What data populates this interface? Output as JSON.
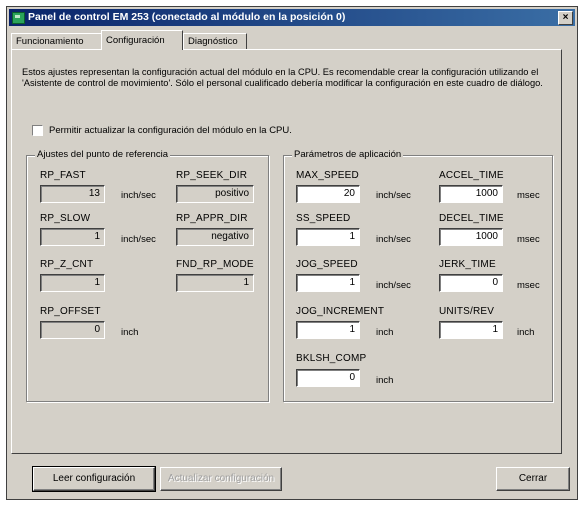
{
  "window": {
    "title": "Panel de control EM 253 (conectado al módulo en la posición 0)",
    "close": "×"
  },
  "tabs": [
    {
      "label": "Funcionamiento"
    },
    {
      "label": "Configuración"
    },
    {
      "label": "Diagnóstico"
    }
  ],
  "description": "Estos ajustes representan la configuración actual del módulo en la CPU. Es recomendable crear la configuración utilizando el 'Asistente de control de movimiento'. Sólo el personal cualificado debería modificar la configuración en este cuadro de diálogo.",
  "checkbox": {
    "label": "Permitir actualizar la configuración del módulo en la CPU.",
    "checked": false
  },
  "ref_group": {
    "title": "Ajustes del punto de referencia",
    "rp_fast": {
      "label": "RP_FAST",
      "value": "13",
      "unit": "inch/sec"
    },
    "rp_seek_dir": {
      "label": "RP_SEEK_DIR",
      "value": "positivo"
    },
    "rp_slow": {
      "label": "RP_SLOW",
      "value": "1",
      "unit": "inch/sec"
    },
    "rp_appr_dir": {
      "label": "RP_APPR_DIR",
      "value": "negativo"
    },
    "rp_z_cnt": {
      "label": "RP_Z_CNT",
      "value": "1"
    },
    "fnd_rp_mode": {
      "label": "FND_RP_MODE",
      "value": "1"
    },
    "rp_offset": {
      "label": "RP_OFFSET",
      "value": "0",
      "unit": "inch"
    }
  },
  "app_group": {
    "title": "Parámetros de aplicación",
    "max_speed": {
      "label": "MAX_SPEED",
      "value": "20",
      "unit": "inch/sec"
    },
    "accel_time": {
      "label": "ACCEL_TIME",
      "value": "1000",
      "unit": "msec"
    },
    "ss_speed": {
      "label": "SS_SPEED",
      "value": "1",
      "unit": "inch/sec"
    },
    "decel_time": {
      "label": "DECEL_TIME",
      "value": "1000",
      "unit": "msec"
    },
    "jog_speed": {
      "label": "JOG_SPEED",
      "value": "1",
      "unit": "inch/sec"
    },
    "jerk_time": {
      "label": "JERK_TIME",
      "value": "0",
      "unit": "msec"
    },
    "jog_increment": {
      "label": "JOG_INCREMENT",
      "value": "1",
      "unit": "inch"
    },
    "units_rev": {
      "label": "UNITS/REV",
      "value": "1",
      "unit": "inch"
    },
    "bklsh_comp": {
      "label": "BKLSH_COMP",
      "value": "0",
      "unit": "inch"
    }
  },
  "buttons": {
    "read": "Leer configuración",
    "update": "Actualizar configuración",
    "close": "Cerrar"
  }
}
